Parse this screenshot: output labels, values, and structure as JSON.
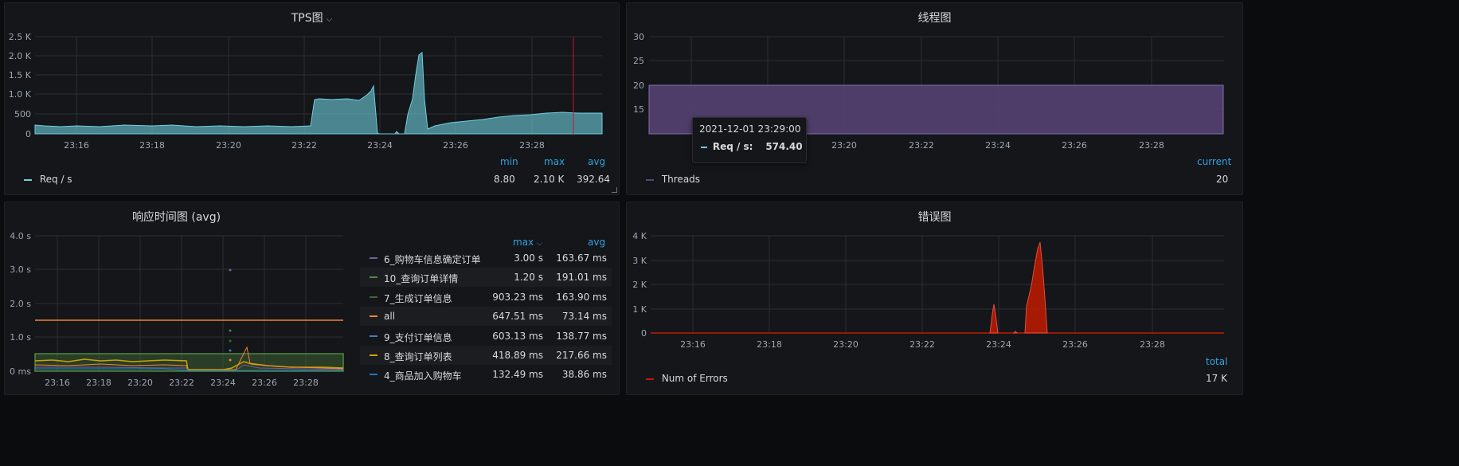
{
  "panels": {
    "tps": {
      "title": "TPS图",
      "yticks": [
        "2.5 K",
        "2.0 K",
        "1.5 K",
        "1.0 K",
        "500",
        "0"
      ],
      "xticks": [
        "23:16",
        "23:18",
        "23:20",
        "23:22",
        "23:24",
        "23:26",
        "23:28"
      ],
      "legend": {
        "headers": [
          "min",
          "max",
          "avg"
        ],
        "series": "Req / s",
        "min": "8.80",
        "max": "2.10 K",
        "avg": "392.64"
      },
      "color": "#6ed0e0"
    },
    "threads": {
      "title": "线程图",
      "yticks": [
        "30",
        "25",
        "20",
        "15"
      ],
      "xticks": [
        "16",
        "23:18",
        "23:20",
        "23:22",
        "23:24",
        "23:26",
        "23:28"
      ],
      "legend": {
        "header": "current",
        "series": "Threads",
        "current": "20"
      },
      "color": "#584477"
    },
    "response": {
      "title": "响应时间图 (avg)",
      "yticks": [
        "4.0 s",
        "3.0 s",
        "2.0 s",
        "1.0 s",
        "0 ms"
      ],
      "xticks": [
        "23:16",
        "23:18",
        "23:20",
        "23:22",
        "23:24",
        "23:26",
        "23:28"
      ],
      "legend_headers": {
        "max": "max",
        "avg": "avg"
      },
      "rows": [
        {
          "name": "6_购物车信息确定订单",
          "max": "3.00 s",
          "avg": "163.67 ms",
          "color": "#705da0"
        },
        {
          "name": "10_查询订单详情",
          "max": "1.20 s",
          "avg": "191.01 ms",
          "color": "#508642"
        },
        {
          "name": "7_生成订单信息",
          "max": "903.23 ms",
          "avg": "163.90 ms",
          "color": "#3f6833"
        },
        {
          "name": "all",
          "max": "647.51 ms",
          "avg": "73.14 ms",
          "color": "#ef843c"
        },
        {
          "name": "9_支付订单信息",
          "max": "603.13 ms",
          "avg": "138.77 ms",
          "color": "#447ebc"
        },
        {
          "name": "8_查询订单列表",
          "max": "418.89 ms",
          "avg": "217.66 ms",
          "color": "#cca300"
        },
        {
          "name": "4_商品加入购物车",
          "max": "132.49 ms",
          "avg": "38.86 ms",
          "color": "#1f78c1"
        }
      ]
    },
    "errors": {
      "title": "错误图",
      "yticks": [
        "4 K",
        "3 K",
        "2 K",
        "1 K",
        "0"
      ],
      "xticks": [
        "23:16",
        "23:18",
        "23:20",
        "23:22",
        "23:24",
        "23:26",
        "23:28"
      ],
      "legend": {
        "header": "total",
        "series": "Num of Errors",
        "total": "17 K"
      },
      "color": "#bf1b00"
    }
  },
  "tooltip": {
    "time": "2021-12-01 23:29:00",
    "series": "Req / s:",
    "value": "574.40"
  },
  "chart_data": [
    {
      "type": "area",
      "title": "TPS图",
      "x_range": [
        "23:15",
        "23:29:50"
      ],
      "ylim": [
        0,
        2500
      ],
      "series": [
        {
          "name": "Req / s",
          "points_approx": [
            [
              "23:15",
              210
            ],
            [
              "23:20",
              205
            ],
            [
              "23:21:30",
              200
            ],
            [
              "23:22:10",
              880
            ],
            [
              "23:23",
              870
            ],
            [
              "23:23:40",
              1230
            ],
            [
              "23:24",
              0
            ],
            [
              "23:24:30",
              0
            ],
            [
              "23:24:45",
              600
            ],
            [
              "23:25:05",
              2080
            ],
            [
              "23:25:20",
              200
            ],
            [
              "23:26",
              280
            ],
            [
              "23:27",
              320
            ],
            [
              "23:28",
              500
            ],
            [
              "23:29",
              574.4
            ],
            [
              "23:29:50",
              550
            ]
          ]
        }
      ]
    },
    {
      "type": "area",
      "title": "线程图",
      "ylim": [
        10,
        30
      ],
      "series": [
        {
          "name": "Threads",
          "value": 20
        }
      ]
    },
    {
      "type": "line",
      "title": "响应时间图 (avg)",
      "ylim_seconds": [
        0,
        4
      ],
      "series": [
        {
          "name": "6_购物车信息确定订单",
          "max_ms": 3000,
          "avg_ms": 163.67
        },
        {
          "name": "10_查询订单详情",
          "max_ms": 1200,
          "avg_ms": 191.01
        },
        {
          "name": "7_生成订单信息",
          "max_ms": 903.23,
          "avg_ms": 163.9
        },
        {
          "name": "all",
          "max_ms": 647.51,
          "avg_ms": 73.14
        },
        {
          "name": "9_支付订单信息",
          "max_ms": 603.13,
          "avg_ms": 138.77
        },
        {
          "name": "8_查询订单列表",
          "max_ms": 418.89,
          "avg_ms": 217.66
        },
        {
          "name": "4_商品加入购物车",
          "max_ms": 132.49,
          "avg_ms": 38.86
        }
      ]
    },
    {
      "type": "area",
      "title": "错误图",
      "ylim": [
        0,
        4000
      ],
      "series": [
        {
          "name": "Num of Errors",
          "points_approx": [
            [
              "23:23:50",
              0
            ],
            [
              "23:23:55",
              1150
            ],
            [
              "23:24:02",
              0
            ],
            [
              "23:24:45",
              0
            ],
            [
              "23:25:05",
              3750
            ],
            [
              "23:25:20",
              0
            ]
          ],
          "total": "17 K"
        }
      ]
    }
  ]
}
